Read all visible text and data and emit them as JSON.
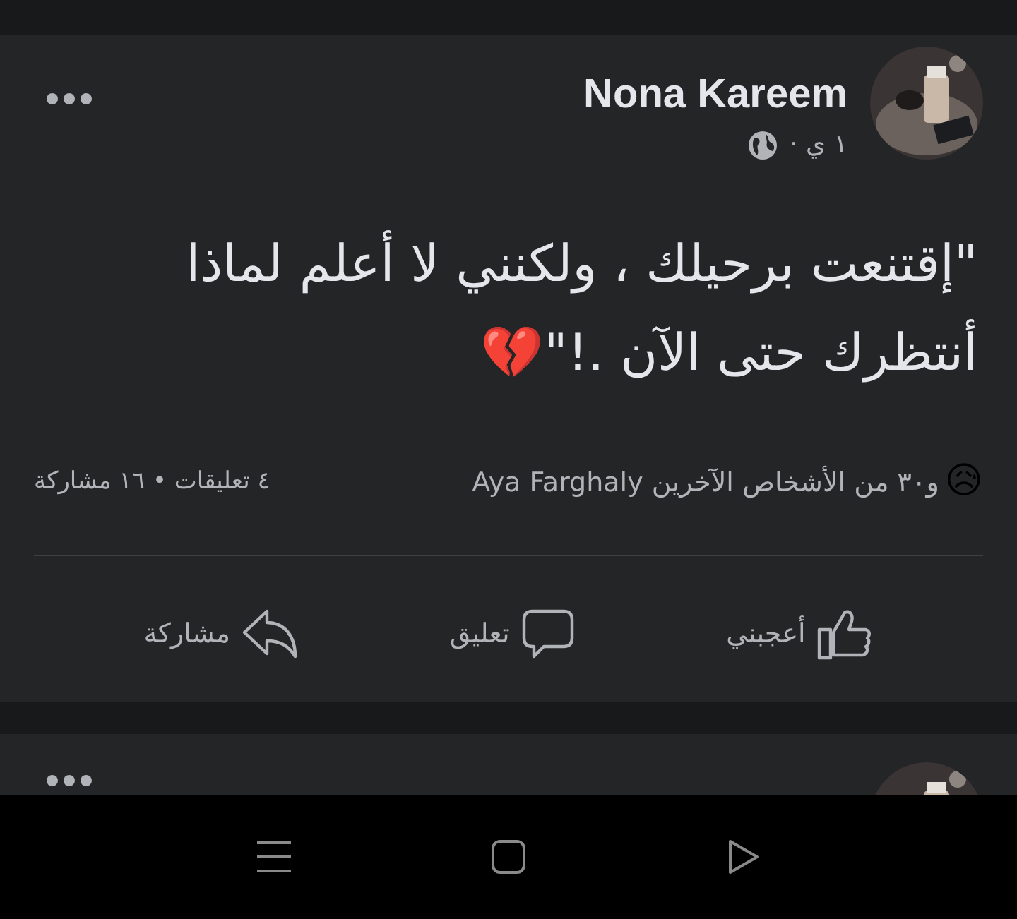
{
  "posts": [
    {
      "author": "Nona Kareem",
      "time": "١ ي ·",
      "text": "\"إقتنعت برحيلك ، ولكنني لا أعلم لماذا أنتظرك حتى الآن .!\"💔",
      "reactions": {
        "emoji": "😥",
        "names": "و٣٠ من الأشخاص الآخرين Aya Farghaly"
      },
      "counts": "٤ تعليقات • ١٦ مشاركة",
      "actions": [
        {
          "kind": "like",
          "label": "أعجبني"
        },
        {
          "kind": "comment",
          "label": "تعليق"
        },
        {
          "kind": "share",
          "label": "مشاركة"
        }
      ]
    },
    {
      "kind": "cut_off"
    }
  ],
  "nav_bar": [
    {
      "kind": "recents"
    },
    {
      "kind": "home"
    },
    {
      "kind": "back"
    }
  ]
}
